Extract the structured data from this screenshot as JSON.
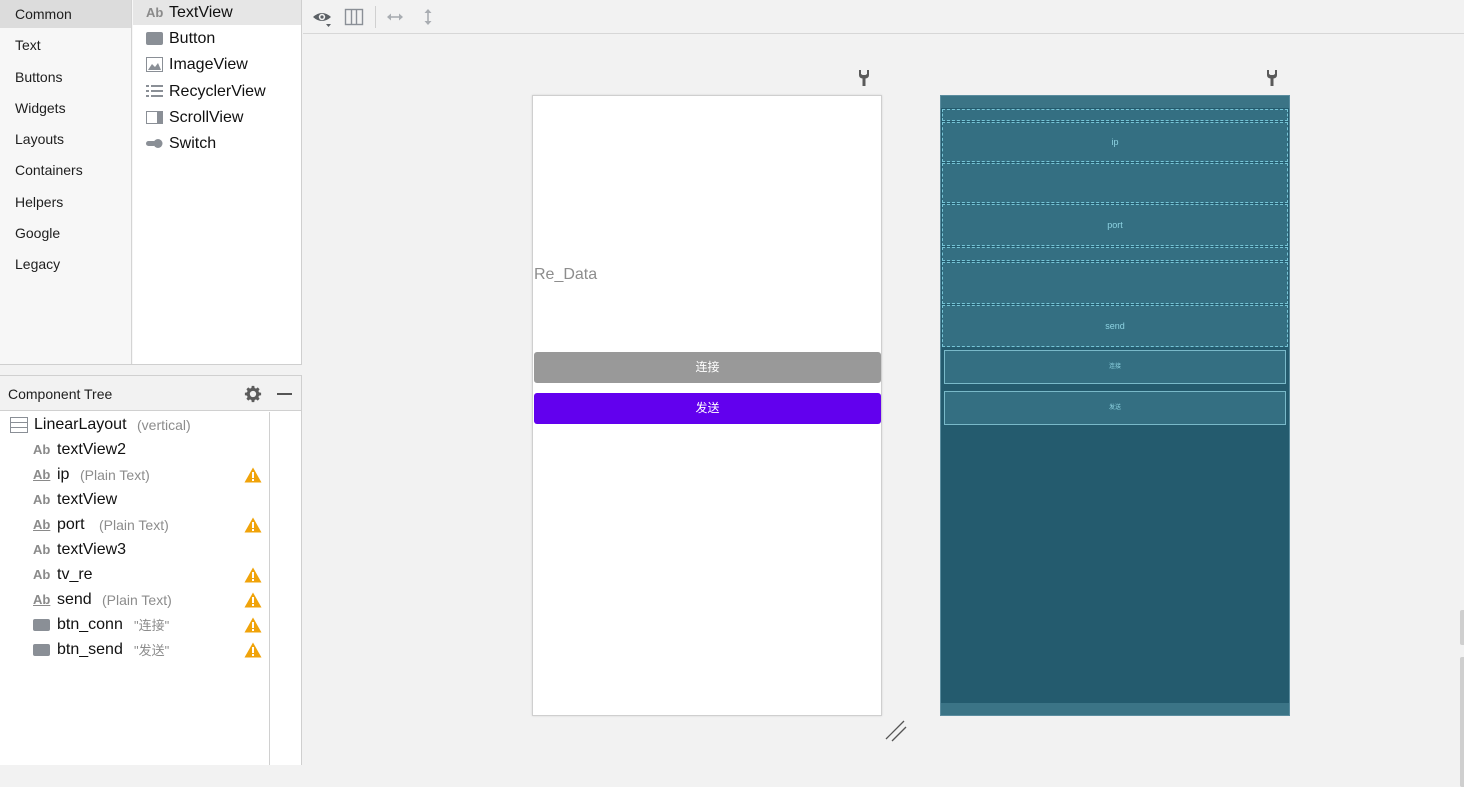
{
  "palette": {
    "categories": [
      "Common",
      "Text",
      "Buttons",
      "Widgets",
      "Layouts",
      "Containers",
      "Helpers",
      "Google",
      "Legacy"
    ],
    "selected_category": "Common",
    "widgets": [
      {
        "label": "TextView",
        "icon": "textview-icon"
      },
      {
        "label": "Button",
        "icon": "button-icon"
      },
      {
        "label": "ImageView",
        "icon": "image-icon"
      },
      {
        "label": "RecyclerView",
        "icon": "list-icon"
      },
      {
        "label": "ScrollView",
        "icon": "scrollview-icon"
      },
      {
        "label": "Switch",
        "icon": "switch-icon"
      }
    ],
    "text_icon_glyph": "Ab"
  },
  "tree": {
    "title": "Component Tree",
    "root": {
      "name": "LinearLayout",
      "hint": "(vertical)"
    },
    "nodes": [
      {
        "name": "textView2",
        "hint": "",
        "kind": "textview",
        "warning": false
      },
      {
        "name": "ip",
        "hint": "(Plain Text)",
        "kind": "edittext",
        "warning": true
      },
      {
        "name": "textView",
        "hint": "",
        "kind": "textview",
        "warning": false
      },
      {
        "name": "port",
        "hint": "(Plain Text)",
        "kind": "edittext",
        "warning": true
      },
      {
        "name": "textView3",
        "hint": "",
        "kind": "textview",
        "warning": false
      },
      {
        "name": "tv_re",
        "hint": "",
        "kind": "textview",
        "warning": true
      },
      {
        "name": "send",
        "hint": "(Plain Text)",
        "kind": "edittext",
        "warning": true
      },
      {
        "name": "btn_conn",
        "hint": "\"连接\"",
        "kind": "button",
        "warning": true
      },
      {
        "name": "btn_send",
        "hint": "\"发送\"",
        "kind": "button",
        "warning": true
      }
    ]
  },
  "design": {
    "tv_re_text": "Re_Data",
    "btn_conn_label": "连接",
    "btn_send_label": "发送"
  },
  "blueprint": {
    "labels": {
      "ip": "ip",
      "port": "port",
      "send": "send",
      "btn_conn": "连接",
      "btn_send": "发送"
    }
  },
  "colors": {
    "accent": "#6200ee",
    "button_gray": "#999999",
    "blueprint_bg": "#245b6e",
    "warning": "#f0a30a"
  }
}
